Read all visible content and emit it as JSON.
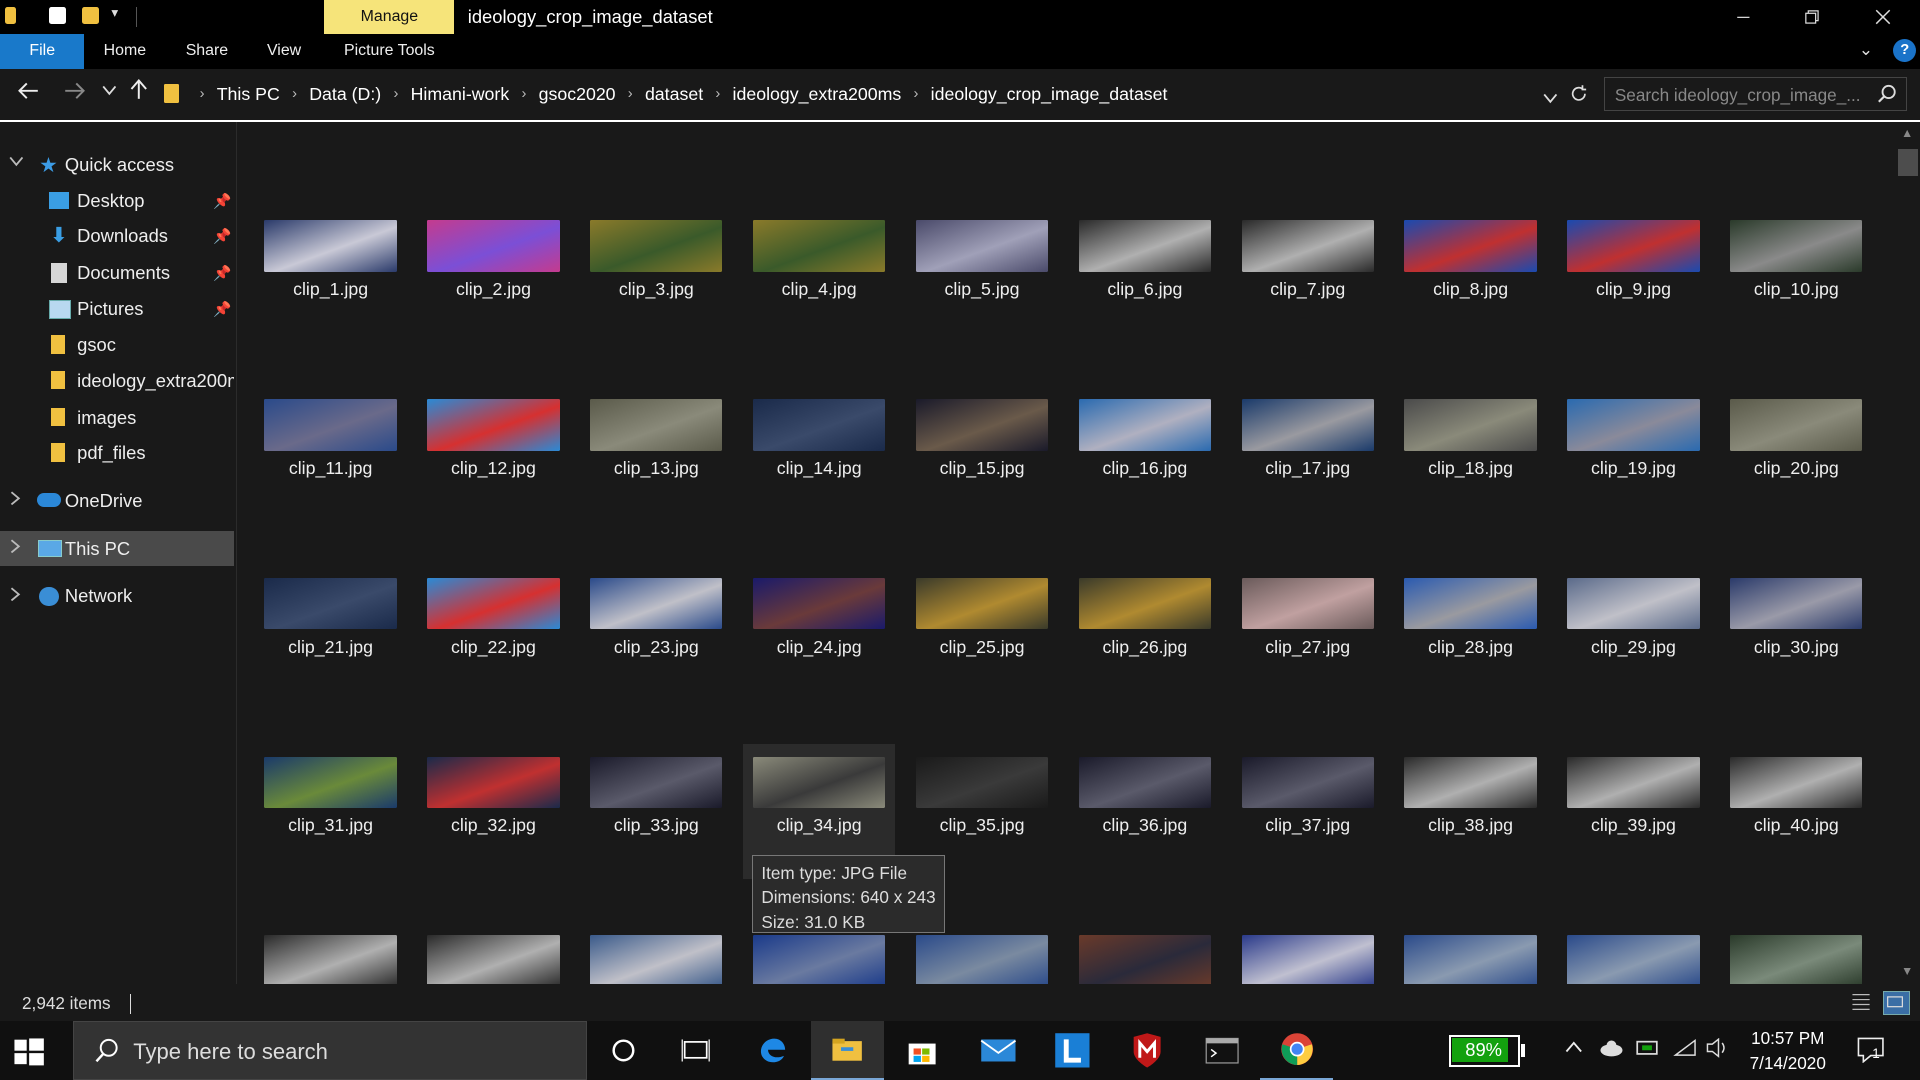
{
  "titlebar": {
    "manage_label": "Manage",
    "window_title": "ideology_crop_image_dataset",
    "minimize_icon": "minimize-icon",
    "maximize_icon": "restore-icon",
    "close_icon": "close-icon"
  },
  "ribbon": {
    "tabs": [
      "File",
      "Home",
      "Share",
      "View",
      "Picture Tools"
    ]
  },
  "address": {
    "crumbs": [
      "This PC",
      "Data (D:)",
      "Himani-work",
      "gsoc2020",
      "dataset",
      "ideology_extra200ms",
      "ideology_crop_image_dataset"
    ],
    "search_placeholder": "Search ideology_crop_image_..."
  },
  "nav": {
    "quick_access": "Quick access",
    "items": [
      {
        "label": "Desktop",
        "pinned": true
      },
      {
        "label": "Downloads",
        "pinned": true
      },
      {
        "label": "Documents",
        "pinned": true
      },
      {
        "label": "Pictures",
        "pinned": true
      },
      {
        "label": "gsoc",
        "pinned": false
      },
      {
        "label": "ideology_extra200ms",
        "pinned": false
      },
      {
        "label": "images",
        "pinned": false
      },
      {
        "label": "pdf_files",
        "pinned": false
      }
    ],
    "onedrive": "OneDrive",
    "this_pc": "This PC",
    "network": "Network"
  },
  "files": [
    "clip_1.jpg",
    "clip_2.jpg",
    "clip_3.jpg",
    "clip_4.jpg",
    "clip_5.jpg",
    "clip_6.jpg",
    "clip_7.jpg",
    "clip_8.jpg",
    "clip_9.jpg",
    "clip_10.jpg",
    "clip_11.jpg",
    "clip_12.jpg",
    "clip_13.jpg",
    "clip_14.jpg",
    "clip_15.jpg",
    "clip_16.jpg",
    "clip_17.jpg",
    "clip_18.jpg",
    "clip_19.jpg",
    "clip_20.jpg",
    "clip_21.jpg",
    "clip_22.jpg",
    "clip_23.jpg",
    "clip_24.jpg",
    "clip_25.jpg",
    "clip_26.jpg",
    "clip_27.jpg",
    "clip_28.jpg",
    "clip_29.jpg",
    "clip_30.jpg",
    "clip_31.jpg",
    "clip_32.jpg",
    "clip_33.jpg",
    "clip_34.jpg",
    "clip_35.jpg",
    "clip_36.jpg",
    "clip_37.jpg",
    "clip_38.jpg",
    "clip_39.jpg",
    "clip_40.jpg"
  ],
  "thumb_colors": [
    [
      "#2a3a6a",
      "#c9c9d6"
    ],
    [
      "#c43b8e",
      "#7b4fd6"
    ],
    [
      "#8a7a2a",
      "#3a5a2a"
    ],
    [
      "#8a7a2a",
      "#3a5a2a"
    ],
    [
      "#4a4a6a",
      "#a0a0b8"
    ],
    [
      "#2a2a2a",
      "#b0b0b0"
    ],
    [
      "#2a2a2a",
      "#b0b0b0"
    ],
    [
      "#1a4ab0",
      "#c03030"
    ],
    [
      "#1a4ab0",
      "#c03030"
    ],
    [
      "#2a3a2a",
      "#8a8a8a"
    ],
    [
      "#2a4a8a",
      "#6a6a8a"
    ],
    [
      "#2a8ad6",
      "#d63030"
    ],
    [
      "#5a5a4a",
      "#8a8a7a"
    ],
    [
      "#1a2a4a",
      "#3a4a6a"
    ],
    [
      "#1a1a2a",
      "#6a5a4a"
    ],
    [
      "#2a6ab0",
      "#b0b0c0"
    ],
    [
      "#1a3a6a",
      "#9a9aa0"
    ],
    [
      "#4a4a4a",
      "#8a8a7a"
    ],
    [
      "#2a6ab0",
      "#8a8a9a"
    ],
    [
      "#5a5a4a",
      "#8a8a7a"
    ],
    [
      "#1a2a4a",
      "#3a4a6a"
    ],
    [
      "#2a8ad6",
      "#d63030"
    ],
    [
      "#2a4a8a",
      "#c0c0c8"
    ],
    [
      "#1a1a6a",
      "#6a3a3a"
    ],
    [
      "#3a3a2a",
      "#b08a30"
    ],
    [
      "#3a3a2a",
      "#b08a30"
    ],
    [
      "#6a5a5a",
      "#c0a0a0"
    ],
    [
      "#2a5ab0",
      "#9a9aa0"
    ],
    [
      "#5a6a8a",
      "#c0c0c8"
    ],
    [
      "#2a3a6a",
      "#9a9aa8"
    ],
    [
      "#1a3a6a",
      "#6a8a3a"
    ],
    [
      "#1a2a4a",
      "#c03030"
    ],
    [
      "#1a1a2a",
      "#5a5a6a"
    ],
    [
      "#8a8a7a",
      "#3a3a3a"
    ],
    [
      "#1a1a1a",
      "#3a3a3a"
    ],
    [
      "#1a1a2a",
      "#5a5a6a"
    ],
    [
      "#1a1a2a",
      "#5a5a6a"
    ],
    [
      "#2a2a2a",
      "#b0b0b0"
    ],
    [
      "#2a2a2a",
      "#b0b0b0"
    ],
    [
      "#2a2a2a",
      "#b0b0b0"
    ],
    [
      "#2a2a2a",
      "#b0b0b0"
    ],
    [
      "#2a2a2a",
      "#b0b0b0"
    ],
    [
      "#3a5a8a",
      "#c0c0c8"
    ],
    [
      "#1a3a8a",
      "#6a7aa0"
    ],
    [
      "#2a4a8a",
      "#7a8aa0"
    ],
    [
      "#6a3a2a",
      "#2a2a3a"
    ],
    [
      "#2a3a8a",
      "#c0c0d0"
    ],
    [
      "#2a4a8a",
      "#8a9ab0"
    ],
    [
      "#2a4a8a",
      "#8a9ab0"
    ],
    [
      "#2a3a2a",
      "#7a8a7a"
    ]
  ],
  "tooltip": {
    "line1": "Item type: JPG File",
    "line2": "Dimensions: 640 x 243",
    "line3": "Size: 31.0 KB"
  },
  "status": {
    "item_count": "2,942 items"
  },
  "taskbar": {
    "search_placeholder": "Type here to search",
    "battery": "89%",
    "battery_level": 0.89,
    "time": "10:57 PM",
    "date": "7/14/2020",
    "notification_count": "1"
  }
}
